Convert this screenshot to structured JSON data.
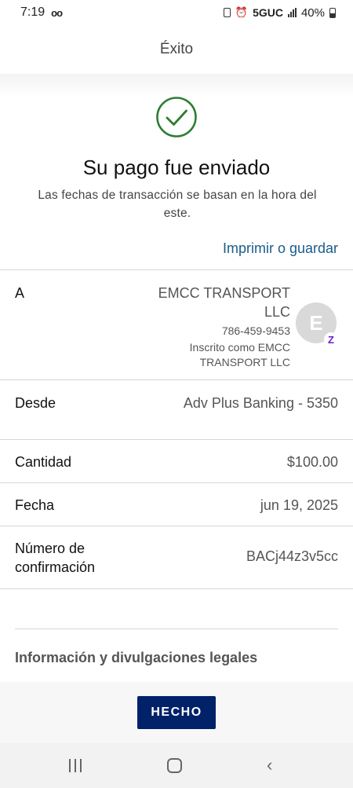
{
  "status_bar": {
    "time": "7:19",
    "voicemail_glyph": "oo",
    "network": "5GUC",
    "battery": "40%"
  },
  "header": {
    "title": "Éxito"
  },
  "confirmation": {
    "title": "Su pago fue enviado",
    "subtitle": "Las fechas de transacción se basan en la hora del este.",
    "print_link": "Imprimir o guardar"
  },
  "details": {
    "to": {
      "label": "A",
      "name": "EMCC TRANSPORT LLC",
      "phone": "786-459-9453",
      "registered_as": "Inscrito como EMCC TRANSPORT LLC",
      "avatar_letter": "E",
      "badge": "Z"
    },
    "from": {
      "label": "Desde",
      "value": "Adv Plus Banking - 5350"
    },
    "amount": {
      "label": "Cantidad",
      "value": "$100.00"
    },
    "date": {
      "label": "Fecha",
      "value": "jun 19, 2025"
    },
    "confirmation_number": {
      "label": "Número de confirmación",
      "value": "BACj44z3v5cc"
    }
  },
  "legal": {
    "heading": "Información y divulgaciones legales"
  },
  "footer": {
    "done_label": "HECHO"
  },
  "colors": {
    "accent": "#1a5c8a",
    "button": "#012169",
    "check": "#2e7d32",
    "zelle": "#6d1ed4"
  }
}
